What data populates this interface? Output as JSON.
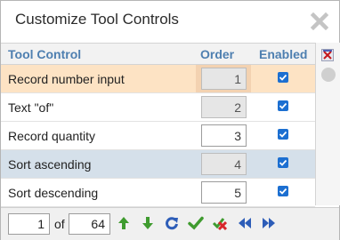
{
  "dialog": {
    "title": "Customize Tool Controls",
    "close_icon": "close-icon"
  },
  "columns": {
    "control": "Tool Control",
    "order": "Order",
    "enabled": "Enabled"
  },
  "rows": [
    {
      "label": "Record number input",
      "order": "1",
      "enabled": true,
      "order_editable": false,
      "state": "selected"
    },
    {
      "label": "Text \"of\"",
      "order": "2",
      "enabled": true,
      "order_editable": false,
      "state": "normal"
    },
    {
      "label": "Record quantity",
      "order": "3",
      "enabled": true,
      "order_editable": true,
      "state": "normal"
    },
    {
      "label": "Sort ascending",
      "order": "4",
      "enabled": true,
      "order_editable": false,
      "state": "highlighted"
    },
    {
      "label": "Sort descending",
      "order": "5",
      "enabled": true,
      "order_editable": true,
      "state": "normal"
    }
  ],
  "sidebar": {
    "icon": "reset-columns-icon"
  },
  "pager": {
    "current": "1",
    "of_label": "of",
    "total": "64"
  },
  "toolbar_icons": [
    "move-up-icon",
    "move-down-icon",
    "refresh-icon",
    "apply-check-icon",
    "cancel-icon",
    "previous-icon",
    "next-icon"
  ],
  "colors": {
    "selected_row": "#fde3c4",
    "highlighted_row": "#d5e0ea",
    "header_text": "#4e7fb0",
    "checkbox": "#1c6fd1"
  }
}
